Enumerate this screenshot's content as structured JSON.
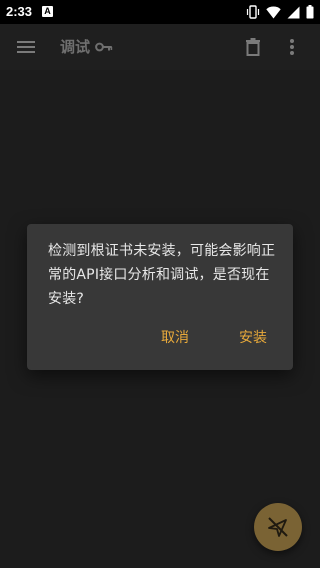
{
  "status_bar": {
    "time": "2:33",
    "notification_icon": "a-icon"
  },
  "app_bar": {
    "title": "调试",
    "title_icon": "key-icon",
    "left_icon": "menu-icon",
    "actions": [
      "delete-icon",
      "more-vert-icon"
    ]
  },
  "dialog": {
    "message": "检测到根证书未安装，可能会影响正常的API接口分析和调试，是否现在安装?",
    "cancel_label": "取消",
    "install_label": "安装"
  },
  "fab": {
    "icon": "send-off-icon"
  },
  "colors": {
    "accent": "#e8a93a",
    "dialog_bg": "#383838",
    "background": "#1c1c1c",
    "fab_bg": "#7a6334"
  }
}
